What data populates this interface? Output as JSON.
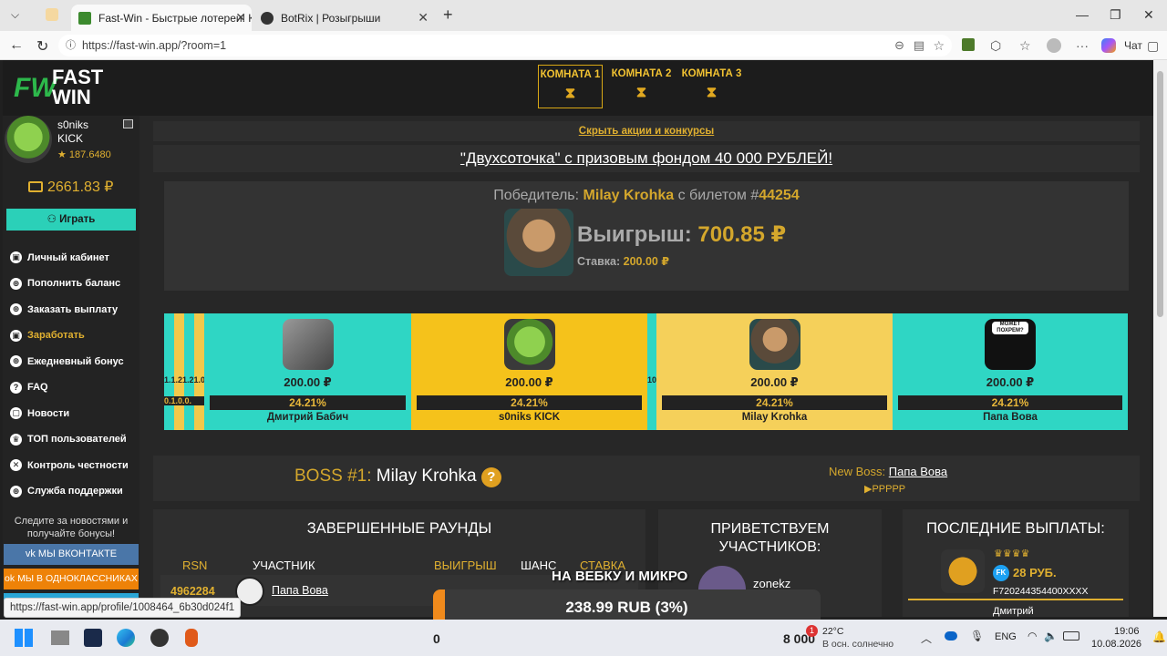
{
  "browser": {
    "tabs": [
      {
        "title": "Fast-Win - Быстрые лотереи! Ком",
        "color": "#3c8a2e"
      },
      {
        "title": "BotRix | Розыгрыши",
        "color": "#222"
      }
    ],
    "url": "https://fast-win.app/?room=1",
    "chat_label": "Чат",
    "status_url": "https://fast-win.app/profile/1008464_6b30d024f1"
  },
  "logo": {
    "line1": "FAST",
    "line2": "WIN",
    "mark": "FW"
  },
  "rooms": [
    {
      "label": "КОМНАТА 1",
      "active": true
    },
    {
      "label": "КОМНАТА 2",
      "active": false
    },
    {
      "label": "КОМНАТА 3",
      "active": false
    }
  ],
  "user": {
    "name": "s0niks",
    "sub": "KICK",
    "rating": "★ 187.6480",
    "balance": "2661.83 ₽",
    "play": "Играть"
  },
  "menu": [
    {
      "label": "Личный кабинет",
      "color": "#fff"
    },
    {
      "label": "Пополнить баланс",
      "color": "#fff"
    },
    {
      "label": "Заказать выплату",
      "color": "#fff"
    },
    {
      "label": "Заработать",
      "color": "#e0b030"
    },
    {
      "label": "Ежедневный бонус",
      "color": "#fff"
    },
    {
      "label": "FAQ",
      "color": "#fff"
    },
    {
      "label": "Новости",
      "color": "#fff"
    },
    {
      "label": "ТОП пользователей",
      "color": "#fff"
    },
    {
      "label": "Контроль честности",
      "color": "#fff"
    },
    {
      "label": "Служба поддержки",
      "color": "#fff"
    }
  ],
  "social": {
    "note": "Следите за новостями и получайте бонусы!",
    "vk": "МЫ ВКОНТАКТЕ",
    "ok": "МЫ В ОДНОКЛАССНИКАХ"
  },
  "promo": {
    "hide": "Скрыть акции и конкурсы",
    "banner": "\"Двухсоточка\" с призовым фондом 40 000 РУБЛЕЙ!"
  },
  "winner": {
    "prefix": "Победитель:",
    "name": "Milay Krohka",
    "ticket_prefix": "с билетом #",
    "ticket": "44254",
    "win_label": "Выигрыш:",
    "win_value": "700.85 ₽",
    "bet_label": "Ставка:",
    "bet_value": "200.00 ₽"
  },
  "cards": [
    {
      "price": "200.00 ₽",
      "percent": "24.21%",
      "name": "Дмитрий Бабич"
    },
    {
      "price": "200.00 ₽",
      "percent": "24.21%",
      "name": "s0niks KICK"
    },
    {
      "price": "200.00 ₽",
      "percent": "24.21%",
      "name": "Milay Krohka"
    },
    {
      "price": "200.00 ₽",
      "percent": "24.21%",
      "name": "Папа Вова"
    }
  ],
  "mini_left": {
    "prices": "1.1.21.21.0",
    "percents": "0.1.0.0."
  },
  "mini_mid": {
    "label": "10"
  },
  "card_mark": "МОЖЕТ ПОХРЕМ?",
  "boss": {
    "label": "BOSS #1:",
    "name": "Milay Krohka",
    "q": "?",
    "new_label": "New Boss:",
    "new_name": "Папа Вова",
    "flags": "▶РРРРР"
  },
  "rounds": {
    "title": "ЗАВЕРШЕННЫЕ РАУНДЫ",
    "cols": [
      "RSN",
      "УЧАСТНИК",
      "ВЫИГРЫШ",
      "ШАНС",
      "СТАВКА"
    ],
    "row": {
      "id": "4962284",
      "name": "Папа Вова"
    }
  },
  "welcome": {
    "title": "ПРИВЕТСТВУЕМ УЧАСТНИКОВ:",
    "user": "zonekz"
  },
  "payouts": {
    "title": "ПОСЛЕДНИЕ ВЫПЛАТЫ:",
    "amount": "28 РУБ.",
    "account": "F720244354400XXXX",
    "next": "Дмитрий"
  },
  "overlay": {
    "title": "НА ВЕБКУ И МИКРО",
    "amount": "238.99 RUB (3%)",
    "left": "0",
    "right": "8 000",
    "progress": 0.03
  },
  "taskbar": {
    "temp": "22°C",
    "weather": "В осн. солнечно",
    "lang": "ENG",
    "time": "19:06",
    "date": "10.08.2026",
    "badge": "1"
  }
}
